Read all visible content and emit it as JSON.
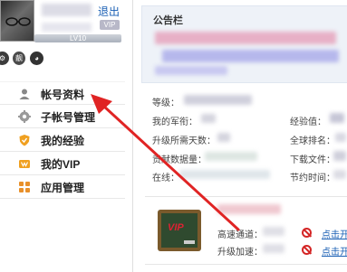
{
  "header": {
    "logout_label": "退出",
    "vip_badge": "VIP",
    "level_label": "LV10",
    "mini_icons": [
      "gear-icon",
      "靓",
      "qq-icon"
    ]
  },
  "sidebar": {
    "items": [
      {
        "label": "帐号资料",
        "icon": "user-icon"
      },
      {
        "label": "子帐号管理",
        "icon": "gear-icon"
      },
      {
        "label": "我的经验",
        "icon": "shield-icon"
      },
      {
        "label": "我的VIP",
        "icon": "vip-icon"
      },
      {
        "label": "应用管理",
        "icon": "apps-grid-icon"
      }
    ]
  },
  "notice": {
    "title": "公告栏"
  },
  "account": {
    "level_label": "等级：",
    "rank_label": "我的军衔：",
    "exp_label": "经验值：",
    "upgrade_days_label": "升级所需天数：",
    "global_rank_label": "全球排名：",
    "upload_label": "贡献数据量：",
    "download_label": "下载文件：",
    "online_label": "在线：",
    "saved_time_label": "节约时间："
  },
  "vip": {
    "board_text": "VIP",
    "fast_channel_label": "高速通道：",
    "upgrade_boost_label": "升级加速：",
    "fast_channel_link": "点击开",
    "upgrade_boost_link": "点击开"
  },
  "colors": {
    "accent_blue": "#1a5fb4",
    "annotation_red": "#e02424",
    "forbid_red": "#d42525"
  }
}
